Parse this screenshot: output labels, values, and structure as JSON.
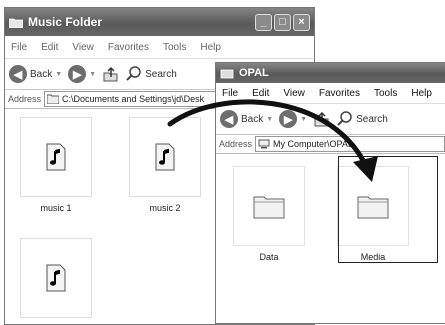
{
  "left_window": {
    "title": "Music Folder",
    "menu": [
      "File",
      "Edit",
      "View",
      "Favorites",
      "Tools",
      "Help"
    ],
    "toolbar": {
      "back": "Back",
      "search": "Search"
    },
    "address": {
      "label": "Address",
      "path": "C:\\Documents and Settings\\jd\\Desk"
    },
    "files": [
      "music 1",
      "music 2",
      ""
    ]
  },
  "right_window": {
    "title": "OPAL",
    "menu": [
      "File",
      "Edit",
      "View",
      "Favorites",
      "Tools",
      "Help"
    ],
    "toolbar": {
      "back": "Back",
      "search": "Search"
    },
    "address": {
      "label": "Address",
      "path": "My Computer\\OPAL"
    },
    "folders": [
      "Data",
      "Media"
    ],
    "selected_folder": "Media"
  }
}
